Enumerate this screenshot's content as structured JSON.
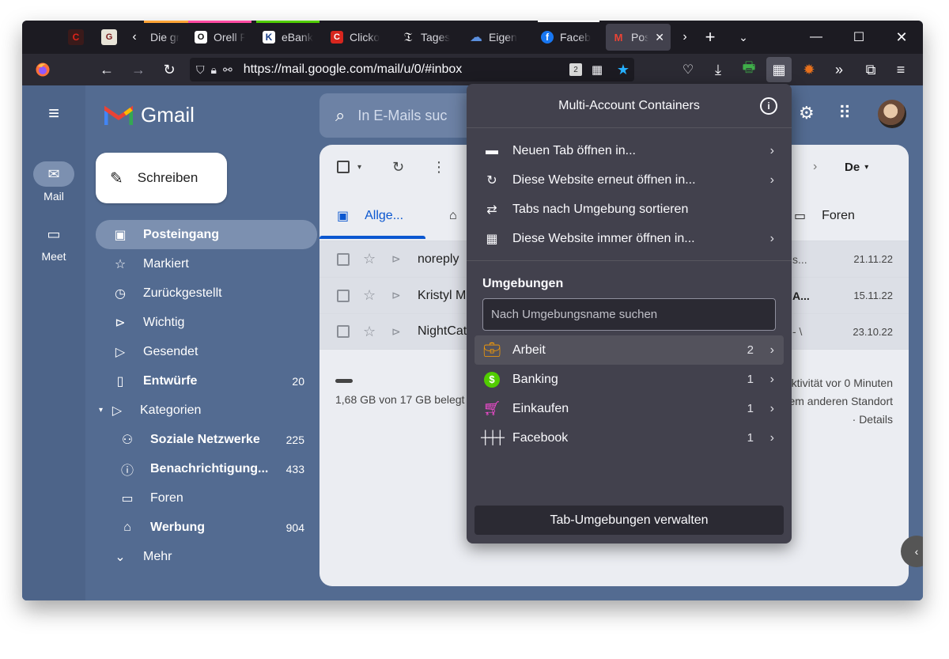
{
  "browser": {
    "tabs": [
      {
        "label": "Die gr",
        "color": "#ffa436",
        "fav": "#d9d9d9"
      },
      {
        "label": "Orell F",
        "color": "#ff4aa2",
        "fav": "#ffffff"
      },
      {
        "label": "eBank",
        "color": "#51cd00",
        "fav": "#2c5fb8"
      },
      {
        "label": "Clicko",
        "color": "",
        "fav": "#d7261e"
      },
      {
        "label": "Tages",
        "color": "",
        "fav": "#ffffff"
      },
      {
        "label": "Eigen",
        "color": "",
        "fav": "#5b8fde"
      },
      {
        "label": "Faceb",
        "color": "",
        "fav": "#1877f2"
      }
    ],
    "active_tab": {
      "label": "Pos",
      "color": "#ffffff"
    },
    "url": "https://mail.google.com/mail/u/0/#inbox"
  },
  "gmail": {
    "logo_text": "Gmail",
    "search_placeholder": "In E-Mails suc",
    "compose_label": "Schreiben",
    "rail": [
      {
        "label": "Mail"
      },
      {
        "label": "Meet"
      }
    ],
    "nav": [
      {
        "label": "Posteingang",
        "count": ""
      },
      {
        "label": "Markiert",
        "count": ""
      },
      {
        "label": "Zurückgestellt",
        "count": ""
      },
      {
        "label": "Wichtig",
        "count": ""
      },
      {
        "label": "Gesendet",
        "count": ""
      },
      {
        "label": "Entwürfe",
        "count": "20"
      },
      {
        "label": "Kategorien",
        "count": ""
      },
      {
        "label": "Soziale Netzwerke",
        "count": "225"
      },
      {
        "label": "Benachrichtigung...",
        "count": "433"
      },
      {
        "label": "Foren",
        "count": ""
      },
      {
        "label": "Werbung",
        "count": "904"
      },
      {
        "label": "Mehr",
        "count": ""
      }
    ],
    "tabs": {
      "primary": "Allge...",
      "forums": "Foren"
    },
    "sort_label": "De",
    "messages": [
      {
        "sender": "noreply",
        "snippet": "s...",
        "date": "21.11.22"
      },
      {
        "sender": "Kristyl M",
        "snippet": "A...",
        "date": "15.11.22"
      },
      {
        "sender": "NightCat",
        "snippet": "- \\",
        "date": "23.10.22"
      }
    ],
    "storage": "1,68 GB von 17 GB belegt",
    "activity": [
      "ktivität vor 0 Minuten",
      "em anderen Standort",
      "· Details"
    ]
  },
  "popup": {
    "title": "Multi-Account Containers",
    "menu": [
      {
        "label": "Neuen Tab öffnen in..."
      },
      {
        "label": "Diese Website erneut öffnen in..."
      },
      {
        "label": "Tabs nach Umgebung sortieren"
      },
      {
        "label": "Diese Website immer öffnen in..."
      }
    ],
    "section_title": "Umgebungen",
    "search_placeholder": "Nach Umgebungsname suchen",
    "containers": [
      {
        "name": "Arbeit",
        "count": "2",
        "color": "#ff9f00",
        "icon": "briefcase-icon"
      },
      {
        "name": "Banking",
        "count": "1",
        "color": "#51cd00",
        "icon": "dollar-icon"
      },
      {
        "name": "Einkaufen",
        "count": "1",
        "color": "#ff4bda",
        "icon": "cart-icon"
      },
      {
        "name": "Facebook",
        "count": "1",
        "color": "#ffffff",
        "icon": "fence-icon"
      }
    ],
    "footer": "Tab-Umgebungen verwalten"
  }
}
